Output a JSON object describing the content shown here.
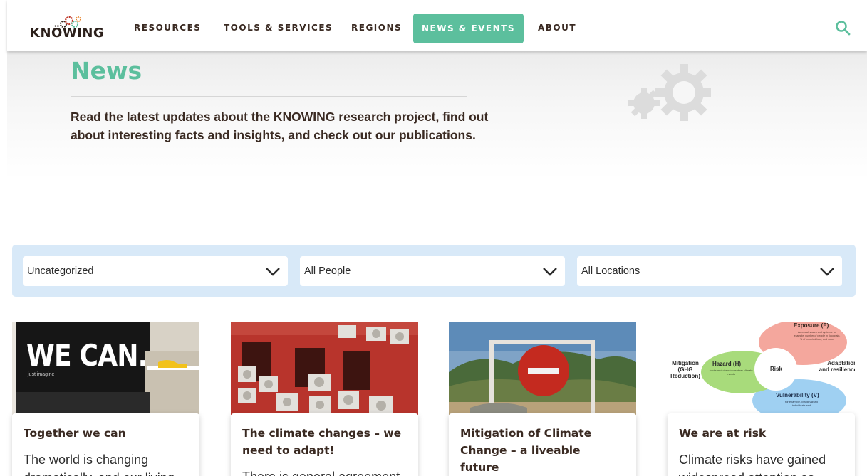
{
  "header": {
    "logo_text": "KNÖWING",
    "nav": [
      {
        "label": "RESOURCES"
      },
      {
        "label": "TOOLS & SERVICES"
      },
      {
        "label": "REGIONS"
      },
      {
        "label": "NEWS & EVENTS",
        "active": true
      },
      {
        "label": "ABOUT"
      }
    ],
    "search_icon": "search-icon"
  },
  "hero": {
    "title": "News",
    "description": "Read the latest updates about the KNOWING research project, find out about interesting facts and insights, and check out our publications.",
    "decoration_icon": "gears-icon"
  },
  "filters": [
    {
      "value": "Uncategorized",
      "icon": "chevron-down-icon"
    },
    {
      "value": "All People",
      "icon": "chevron-down-icon"
    },
    {
      "value": "All Locations",
      "icon": "chevron-down-icon"
    }
  ],
  "posts": [
    {
      "title": "Together we can",
      "excerpt": "The world is changing dramatically, and our living",
      "image": {
        "headline": "WE CAN.",
        "tagline": "just imagine"
      }
    },
    {
      "title": "The climate changes – we need to adapt!",
      "excerpt": "There is general agreement",
      "image": {}
    },
    {
      "title": "Mitigation of Climate Change – a liveable future",
      "excerpt": "",
      "image": {}
    },
    {
      "title": "We are at risk",
      "excerpt": "Climate risks have gained widespread attention as",
      "image": {
        "exposure": "Exposure (E)",
        "exposure_note": "Across all scales and systems: for example, number of people in floodplain, % of imported food, and so on",
        "hazard": "Hazard (H)",
        "hazard_note": "Acute and chronic weather climate events",
        "risk": "Risk",
        "vulnerability": "Vulnerability (V)",
        "vulnerability_note": "for example, Marginalised individuals and",
        "mitigation": "Mitigation (GHG Reduction)",
        "adaptation": "Adaptation and resilience"
      }
    }
  ],
  "colors": {
    "accent": "#5cbf9d",
    "text": "#3a2a22",
    "filter_bg": "#d8e9f8"
  }
}
